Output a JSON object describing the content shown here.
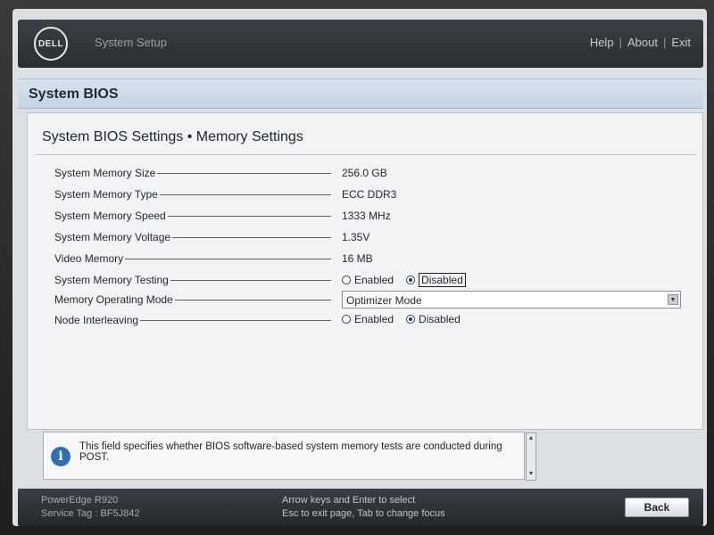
{
  "header": {
    "logo_text": "DELL",
    "app_title": "System Setup",
    "links": [
      "Help",
      "About",
      "Exit"
    ]
  },
  "bios_title": "System BIOS",
  "page_title": "System BIOS Settings • Memory Settings",
  "settings": {
    "memory_size": {
      "label": "System Memory Size",
      "value": "256.0 GB"
    },
    "memory_type": {
      "label": "System Memory Type",
      "value": "ECC DDR3"
    },
    "memory_speed": {
      "label": "System Memory Speed",
      "value": "1333 MHz"
    },
    "memory_voltage": {
      "label": "System Memory Voltage",
      "value": "1.35V"
    },
    "video_memory": {
      "label": "Video Memory",
      "value": "16 MB"
    },
    "memory_testing": {
      "label": "System Memory Testing",
      "options": [
        "Enabled",
        "Disabled"
      ],
      "selected": "Disabled"
    },
    "operating_mode": {
      "label": "Memory Operating Mode",
      "value": "Optimizer Mode"
    },
    "node_interleaving": {
      "label": "Node Interleaving",
      "options": [
        "Enabled",
        "Disabled"
      ],
      "selected": "Disabled"
    }
  },
  "help": {
    "icon": "info-icon",
    "text": "This field specifies whether BIOS software-based system memory tests are conducted during POST."
  },
  "footer": {
    "model": "PowerEdge R920",
    "service_tag": "Service Tag : BF5J842",
    "hint_line1": "Arrow keys and Enter to select",
    "hint_line2": "Esc to exit page, Tab to change focus",
    "back_label": "Back"
  },
  "colors": {
    "header_bg": "#2f3236",
    "band_bg": "#cdd9e7",
    "panel_bg": "#f2f3f4",
    "info_blue": "#2f6fb5"
  }
}
